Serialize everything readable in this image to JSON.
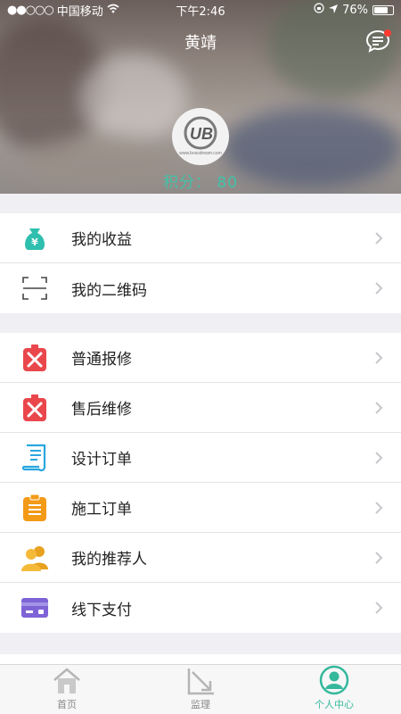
{
  "status": {
    "carrier": "中国移动",
    "time": "下午2:46",
    "battery": "76%",
    "battery_level": 0.76
  },
  "header": {
    "title": "黄靖",
    "avatar_text": "www.bossdream.com",
    "points": "积分：  80"
  },
  "group1": [
    {
      "label": "我的收益",
      "icon": "money-bag-icon"
    },
    {
      "label": "我的二维码",
      "icon": "qr-scan-icon"
    }
  ],
  "group2": [
    {
      "label": "普通报修",
      "icon": "repair-tools-icon"
    },
    {
      "label": "售后维修",
      "icon": "repair-tools-icon"
    },
    {
      "label": "设计订单",
      "icon": "design-scroll-icon"
    },
    {
      "label": "施工订单",
      "icon": "clipboard-icon"
    },
    {
      "label": "我的推荐人",
      "icon": "people-icon"
    },
    {
      "label": "线下支付",
      "icon": "card-icon"
    }
  ],
  "tabs": [
    {
      "label": "首页",
      "icon": "home-icon"
    },
    {
      "label": "监理",
      "icon": "supervision-icon"
    },
    {
      "label": "个人中心",
      "icon": "profile-icon",
      "active": true
    }
  ],
  "colors": {
    "accent": "#35b89c",
    "points": "#41c2a6"
  }
}
